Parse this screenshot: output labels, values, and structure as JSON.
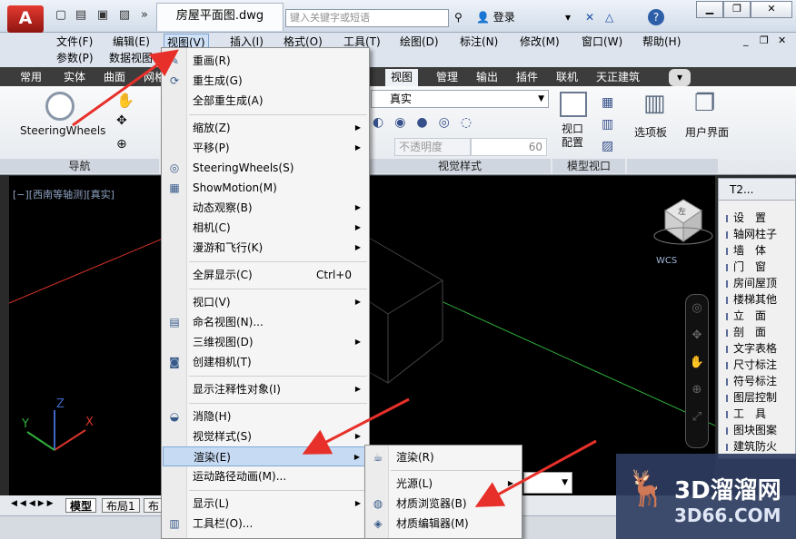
{
  "titlebar": {
    "app_logo": "A",
    "doc_title": "房屋平面图.dwg",
    "search_placeholder": "键入关键字或短语",
    "login": "登录",
    "help": "?"
  },
  "menubar": {
    "items": [
      "文件(F)",
      "编辑(E)",
      "视图(V)",
      "插入(I)",
      "格式(O)",
      "工具(T)",
      "绘图(D)",
      "标注(N)",
      "修改(M)",
      "窗口(W)",
      "帮助(H)"
    ],
    "row2": [
      "参数(P)",
      "数据视图"
    ]
  },
  "ribbon_tabs": [
    "常用",
    "实体",
    "曲面",
    "网格",
    "视图",
    "管理",
    "输出",
    "插件",
    "联机",
    "天正建筑"
  ],
  "ribbon": {
    "steering": "SteeringWheels",
    "nav_label": "导航",
    "visual_style_value": "真实",
    "opacity_placeholder": "不透明度",
    "opacity_value": "60",
    "visual_style_label": "视觉样式",
    "viewport_config": "视口\n配置",
    "model_viewport_label": "模型视口",
    "options_board": "选项板",
    "user_interface": "用户界面"
  },
  "viewport": {
    "label": "[−][西南等轴测][真实]",
    "wcs": "WCS",
    "cube_face": "左"
  },
  "view_menu": {
    "items": [
      {
        "label": "重画(R)",
        "icon": "pencil-icon"
      },
      {
        "label": "重生成(G)"
      },
      {
        "label": "全部重生成(A)"
      },
      {
        "sep": true
      },
      {
        "label": "缩放(Z)",
        "submenu": true
      },
      {
        "label": "平移(P)",
        "submenu": true
      },
      {
        "label": "SteeringWheels(S)",
        "icon": "steering-wheel-icon"
      },
      {
        "label": "ShowMotion(M)",
        "icon": "showmotion-icon"
      },
      {
        "label": "动态观察(B)",
        "submenu": true
      },
      {
        "label": "相机(C)",
        "submenu": true
      },
      {
        "label": "漫游和飞行(K)",
        "submenu": true
      },
      {
        "sep": true
      },
      {
        "label": "全屏显示(C)",
        "shortcut": "Ctrl+0"
      },
      {
        "sep": true
      },
      {
        "label": "视口(V)",
        "submenu": true
      },
      {
        "label": "命名视图(N)...",
        "icon": "named-view-icon"
      },
      {
        "label": "三维视图(D)",
        "submenu": true
      },
      {
        "label": "创建相机(T)",
        "icon": "camera-icon"
      },
      {
        "sep": true
      },
      {
        "label": "显示注释性对象(I)",
        "submenu": true
      },
      {
        "sep": true
      },
      {
        "label": "消隐(H)",
        "icon": "hide-icon"
      },
      {
        "label": "视觉样式(S)",
        "submenu": true
      },
      {
        "label": "渲染(E)",
        "submenu": true,
        "highlight": true
      },
      {
        "label": "运动路径动画(M)..."
      },
      {
        "sep": true
      },
      {
        "label": "显示(L)",
        "submenu": true
      },
      {
        "label": "工具栏(O)...",
        "icon": "toolbar-icon"
      }
    ]
  },
  "render_submenu": {
    "items": [
      {
        "label": "渲染(R)",
        "icon": "teapot-icon"
      },
      {
        "sep": true
      },
      {
        "label": "光源(L)",
        "submenu": true
      },
      {
        "label": "材质浏览器(B)",
        "icon": "material-browser-icon"
      },
      {
        "label": "材质编辑器(M)",
        "icon": "material-editor-icon"
      }
    ]
  },
  "side_panel": {
    "title": "T2...",
    "items": [
      "设　置",
      "轴网柱子",
      "墙　体",
      "门　窗",
      "房间屋顶",
      "楼梯其他",
      "立　面",
      "剖　面",
      "文字表格",
      "尺寸标注",
      "符号标注",
      "图层控制",
      "工　具",
      "图块图案",
      "建筑防火"
    ]
  },
  "bottom_tabs": [
    "模型",
    "布局1",
    "布"
  ],
  "watermark": {
    "brand": "3D溜溜网",
    "url": "3D66.COM"
  }
}
